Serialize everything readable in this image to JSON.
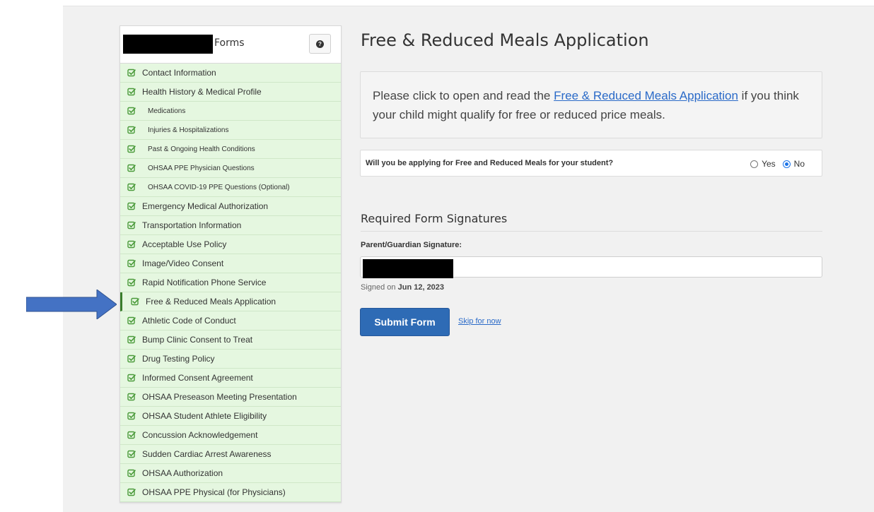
{
  "sidebar": {
    "title": "Forms",
    "help_icon": "question-circle-icon",
    "items": [
      {
        "label": "Contact Information",
        "sub": false
      },
      {
        "label": "Health History & Medical Profile",
        "sub": false
      },
      {
        "label": "Medications",
        "sub": true
      },
      {
        "label": "Injuries & Hospitalizations",
        "sub": true
      },
      {
        "label": "Past & Ongoing Health Conditions",
        "sub": true
      },
      {
        "label": "OHSAA PPE Physician Questions",
        "sub": true
      },
      {
        "label": "OHSAA COVID-19 PPE Questions (Optional)",
        "sub": true
      },
      {
        "label": "Emergency Medical Authorization",
        "sub": false
      },
      {
        "label": "Transportation Information",
        "sub": false
      },
      {
        "label": "Acceptable Use Policy",
        "sub": false
      },
      {
        "label": "Image/Video Consent",
        "sub": false
      },
      {
        "label": "Rapid Notification Phone Service",
        "sub": false
      },
      {
        "label": "Free & Reduced Meals Application",
        "sub": false,
        "active": true
      },
      {
        "label": "Athletic Code of Conduct",
        "sub": false
      },
      {
        "label": "Bump Clinic Consent to Treat",
        "sub": false
      },
      {
        "label": "Drug Testing Policy",
        "sub": false
      },
      {
        "label": "Informed Consent Agreement",
        "sub": false
      },
      {
        "label": "OHSAA Preseason Meeting Presentation",
        "sub": false
      },
      {
        "label": "OHSAA Student Athlete Eligibility",
        "sub": false
      },
      {
        "label": "Concussion Acknowledgement",
        "sub": false
      },
      {
        "label": "Sudden Cardiac Arrest Awareness",
        "sub": false
      },
      {
        "label": "OHSAA Authorization",
        "sub": false
      },
      {
        "label": "OHSAA PPE Physical (for Physicians)",
        "sub": false
      }
    ]
  },
  "main": {
    "title": "Free & Reduced Meals Application",
    "info_prefix": "Please click to open and read the ",
    "info_link": "Free & Reduced Meals Application",
    "info_suffix": " if you think your child might qualify for free or reduced price meals.",
    "question": "Will you be applying for Free and Reduced Meals for your student?",
    "options": [
      {
        "label": "Yes",
        "checked": false
      },
      {
        "label": "No",
        "checked": true
      }
    ],
    "signatures_heading": "Required Form Signatures",
    "signature_label": "Parent/Guardian Signature:",
    "signed_on_prefix": "Signed on ",
    "signed_on_date": "Jun 12, 2023",
    "submit_label": "Submit Form",
    "skip_label": "Skip for now"
  },
  "colors": {
    "completed_item_bg": "#e5f7e0",
    "check_icon": "#4a9a3a",
    "primary_button": "#2e6bb5",
    "arrow": "#4472c4",
    "link": "#2a6ac8"
  }
}
